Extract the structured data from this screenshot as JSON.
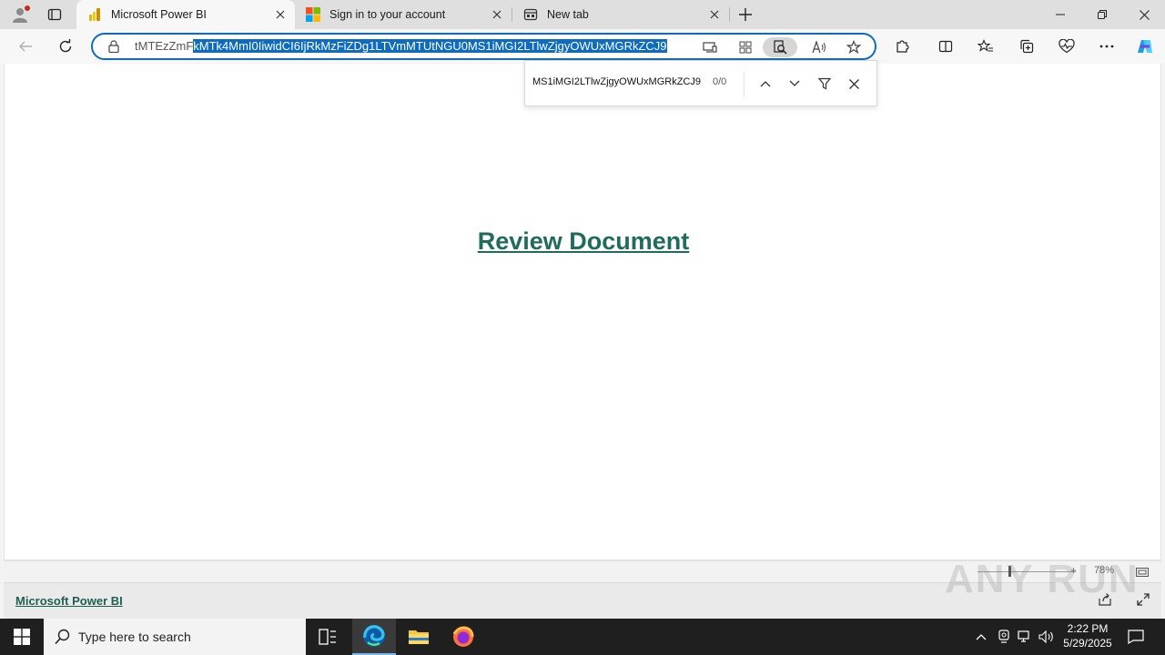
{
  "browser": {
    "tabs": [
      {
        "title": "Microsoft Power BI",
        "active": true,
        "favicon": "power-bi-icon"
      },
      {
        "title": "Sign in to your account",
        "active": false,
        "favicon": "microsoft-icon"
      },
      {
        "title": "New tab",
        "active": false,
        "favicon": "new-tab-page-icon"
      }
    ],
    "address": {
      "url_prefix": "tMTEzZmF",
      "url_selected": "kMTk4MmI0IiwidCI6IjRkMzFiZDg1LTVmMTUtNGU0MS1iMGI2LTlwZjgyOWUxMGRkZCJ9"
    },
    "find": {
      "query": "MS1iMGI2LTlwZjgyOWUxMGRkZCJ9",
      "count": "0/0"
    }
  },
  "page": {
    "link": "Review Document",
    "footer_brand": "Microsoft Power BI",
    "zoom_plus": "+",
    "zoom_label": "78%"
  },
  "watermark": "ANY RUN",
  "taskbar": {
    "search_placeholder": "Type here to search",
    "time": "2:22 PM",
    "date": "5/29/2025"
  },
  "colors": {
    "accent": "#0f6cbd",
    "link": "#1f6b5c",
    "taskbar": "#1f1f1f"
  }
}
